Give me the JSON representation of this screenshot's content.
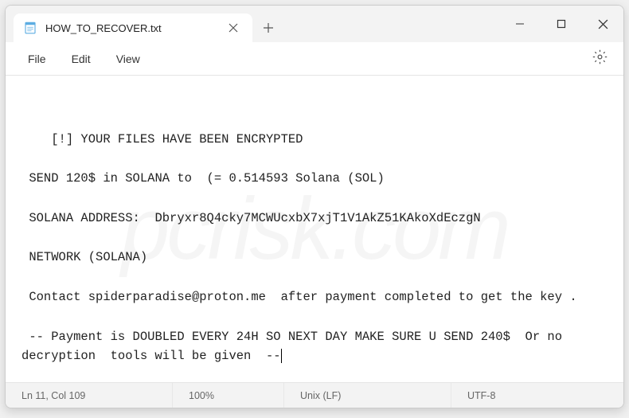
{
  "tab": {
    "title": "HOW_TO_RECOVER.txt"
  },
  "menu": {
    "file": "File",
    "edit": "Edit",
    "view": "View"
  },
  "document": {
    "lines": [
      "[!] YOUR FILES HAVE BEEN ENCRYPTED",
      "",
      " SEND 120$ in SOLANA to  (= 0.514593 Solana (SOL)",
      "",
      " SOLANA ADDRESS:  Dbryxr8Q4cky7MCWUcxbX7xjT1V1AkZ51KAkoXdEczgN",
      "",
      " NETWORK (SOLANA)",
      "",
      " Contact spiderparadise@proton.me  after payment completed to get the key .",
      "",
      " -- Payment is DOUBLED EVERY 24H SO NEXT DAY MAKE SURE U SEND 240$  Or no decryption  tools will be given  --"
    ],
    "amount_usd": 120,
    "amount_sol": 0.514593,
    "solana_address": "Dbryxr8Q4cky7MCWUcxbX7xjT1V1AkZ51KAkoXdEczgN",
    "contact_email": "spiderparadise@proton.me",
    "doubled_amount_usd": 240
  },
  "status": {
    "position": "Ln 11, Col 109",
    "zoom": "100%",
    "line_ending": "Unix (LF)",
    "encoding": "UTF-8"
  },
  "watermark": "pcrisk.com"
}
